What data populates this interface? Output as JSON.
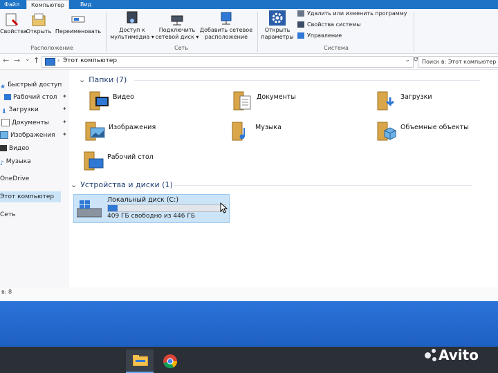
{
  "tabs": [
    "Файл",
    "Компьютер",
    "Вид"
  ],
  "ribbon": {
    "location": {
      "label": "Расположение",
      "buttons": [
        "Свойства",
        "Открыть",
        "Переименовать"
      ]
    },
    "network": {
      "label": "Сеть",
      "buttons": [
        {
          "line1": "Доступ к",
          "line2": "мультимедиа ▾"
        },
        {
          "line1": "Подключить",
          "line2": "сетевой диск ▾"
        },
        {
          "line1": "Добавить сетевое",
          "line2": "расположение"
        }
      ]
    },
    "open_settings": {
      "line1": "Открыть",
      "line2": "параметры"
    },
    "system": {
      "label": "Система",
      "items": [
        "Удалить или изменить программу",
        "Свойства системы",
        "Управление"
      ]
    }
  },
  "address": {
    "path": "Этот компьютер",
    "search_placeholder": "Поиск в: Этот компьютер"
  },
  "nav": [
    {
      "label": "Быстрый доступ",
      "icon": "star-icon"
    },
    {
      "label": "Рабочий стол",
      "icon": "desktop-icon",
      "pinned": true
    },
    {
      "label": "Загрузки",
      "icon": "download-icon",
      "pinned": true
    },
    {
      "label": "Документы",
      "icon": "document-icon",
      "pinned": true
    },
    {
      "label": "Изображения",
      "icon": "image-icon",
      "pinned": true
    },
    {
      "label": "Видео",
      "icon": "video-icon"
    },
    {
      "label": "Музыка",
      "icon": "music-icon"
    },
    {
      "label": "OneDrive",
      "icon": "cloud-icon"
    },
    {
      "label": "Этот компьютер",
      "icon": "computer-icon",
      "selected": true
    },
    {
      "label": "Сеть",
      "icon": "network-icon"
    }
  ],
  "folders_section": {
    "title": "Папки (7)"
  },
  "folders": [
    {
      "label": "Видео",
      "icon": "video-folder-icon"
    },
    {
      "label": "Документы",
      "icon": "documents-folder-icon"
    },
    {
      "label": "Загрузки",
      "icon": "downloads-folder-icon"
    },
    {
      "label": "Изображения",
      "icon": "pictures-folder-icon"
    },
    {
      "label": "Музыка",
      "icon": "music-folder-icon"
    },
    {
      "label": "Объемные объекты",
      "icon": "3d-objects-folder-icon"
    },
    {
      "label": "Рабочий стол",
      "icon": "desktop-folder-icon"
    }
  ],
  "devices_section": {
    "title": "Устройства и диски (1)"
  },
  "drive": {
    "label": "Локальный диск (C:)",
    "space": "409 ГБ свободно из 446 ГБ",
    "used_fraction": 0.083
  },
  "status": {
    "items": "в: 8"
  },
  "taskbar": {
    "apps": [
      "file-explorer-icon",
      "chrome-icon"
    ]
  },
  "watermark": "Avito",
  "colors": {
    "accent": "#1d73c6",
    "selection": "#cce4f7",
    "desktop": "#2c73d9"
  }
}
